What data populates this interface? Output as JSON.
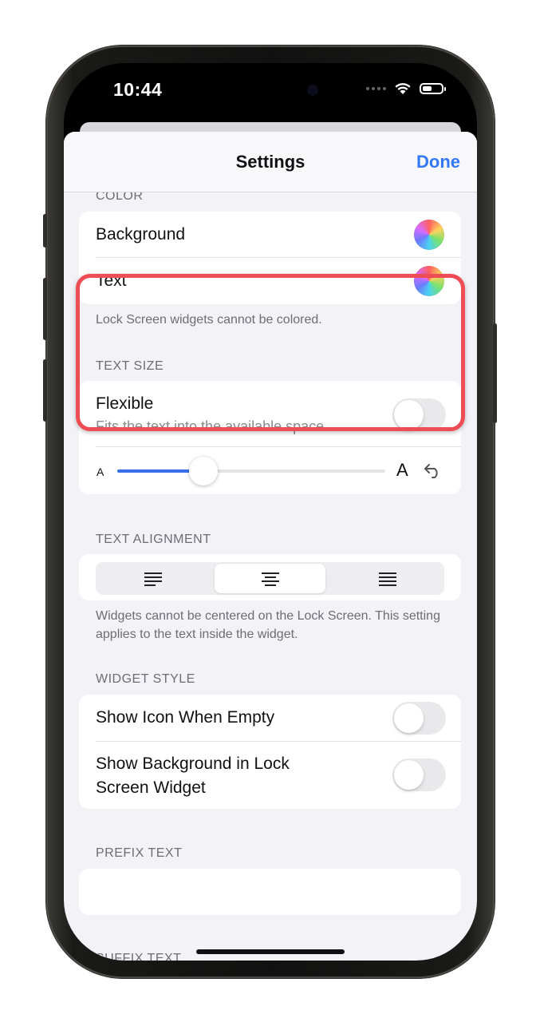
{
  "status_bar": {
    "time": "10:44"
  },
  "nav": {
    "title": "Settings",
    "done_label": "Done"
  },
  "color_section": {
    "header": "COLOR",
    "rows": [
      {
        "label": "Background",
        "control": "color-picker"
      },
      {
        "label": "Text",
        "control": "color-picker"
      }
    ],
    "footnote": "Lock Screen widgets cannot be colored."
  },
  "text_size_section": {
    "header": "TEXT SIZE",
    "flexible": {
      "label": "Flexible",
      "subtitle": "Fits the text into the available space",
      "on": false
    },
    "slider": {
      "min_label": "A",
      "max_label": "A",
      "value": 0.32
    },
    "highlight_color": "#ef4d55"
  },
  "text_alignment_section": {
    "header": "TEXT ALIGNMENT",
    "options": [
      "left",
      "center",
      "right"
    ],
    "selected": "center",
    "footnote": "Widgets cannot be centered on the Lock Screen. This setting applies to the text inside the widget."
  },
  "widget_style_section": {
    "header": "WIDGET STYLE",
    "rows": [
      {
        "label": "Show Icon When Empty",
        "on": false
      },
      {
        "label": "Show Background in Lock Screen Widget",
        "on": false
      }
    ]
  },
  "prefix_text_section": {
    "header": "PREFIX TEXT",
    "value": ""
  },
  "suffix_text_section": {
    "header": "SUFFIX TEXT"
  },
  "colors": {
    "accent": "#3478f6",
    "slider_fill": "#3a6ee8",
    "background": "#f2f2f7"
  }
}
